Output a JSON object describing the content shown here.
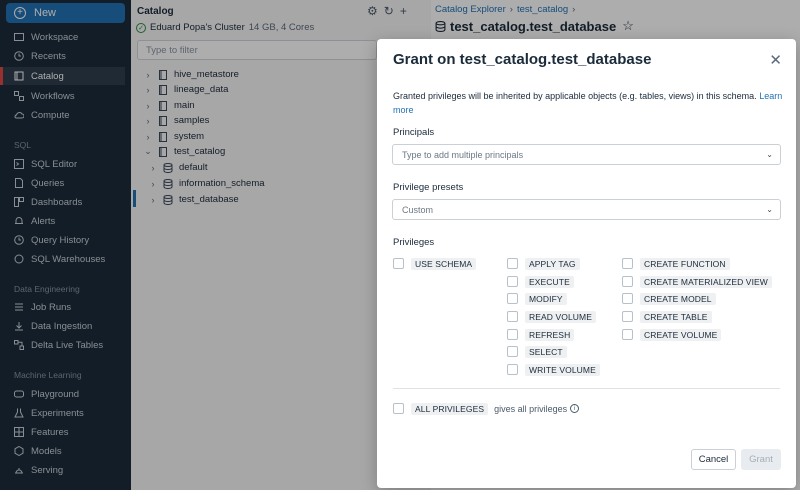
{
  "sidebar": {
    "new_label": "New",
    "items": [
      {
        "label": "Workspace",
        "icon": "folder-icon"
      },
      {
        "label": "Recents",
        "icon": "clock-icon"
      },
      {
        "label": "Catalog",
        "icon": "catalog-icon"
      },
      {
        "label": "Workflows",
        "icon": "workflows-icon"
      },
      {
        "label": "Compute",
        "icon": "cloud-icon"
      }
    ],
    "sql_section": "SQL",
    "sql_items": [
      {
        "label": "SQL Editor",
        "icon": "editor-icon"
      },
      {
        "label": "Queries",
        "icon": "queries-icon"
      },
      {
        "label": "Dashboards",
        "icon": "dashboard-icon"
      },
      {
        "label": "Alerts",
        "icon": "bell-icon"
      },
      {
        "label": "Query History",
        "icon": "history-icon"
      },
      {
        "label": "SQL Warehouses",
        "icon": "warehouse-icon"
      }
    ],
    "de_section": "Data Engineering",
    "de_items": [
      {
        "label": "Job Runs",
        "icon": "jobs-icon"
      },
      {
        "label": "Data Ingestion",
        "icon": "ingestion-icon"
      },
      {
        "label": "Delta Live Tables",
        "icon": "pipeline-icon"
      }
    ],
    "ml_section": "Machine Learning",
    "ml_items": [
      {
        "label": "Playground",
        "icon": "playground-icon"
      },
      {
        "label": "Experiments",
        "icon": "flask-icon"
      },
      {
        "label": "Features",
        "icon": "features-icon"
      },
      {
        "label": "Models",
        "icon": "models-icon"
      },
      {
        "label": "Serving",
        "icon": "serving-icon"
      }
    ]
  },
  "catalog": {
    "title": "Catalog",
    "cluster_name": "Eduard Popa's Cluster",
    "cluster_meta": "14 GB, 4 Cores",
    "filter_placeholder": "Type to filter",
    "tree": [
      "hive_metastore",
      "lineage_data",
      "main",
      "samples",
      "system",
      "test_catalog",
      "default",
      "information_schema",
      "test_database"
    ]
  },
  "header": {
    "crumb1": "Catalog Explorer",
    "crumb2": "test_catalog",
    "title": "test_catalog.test_database"
  },
  "modal": {
    "title": "Grant on test_catalog.test_database",
    "description": "Granted privileges will be inherited by applicable objects (e.g. tables, views) in this schema.",
    "learn_more": "Learn more",
    "principals_label": "Principals",
    "principals_placeholder": "Type to add multiple principals",
    "presets_label": "Privilege presets",
    "presets_value": "Custom",
    "privileges_label": "Privileges",
    "col1": [
      "USE SCHEMA"
    ],
    "col2": [
      "APPLY TAG",
      "EXECUTE",
      "MODIFY",
      "READ VOLUME",
      "REFRESH",
      "SELECT",
      "WRITE VOLUME"
    ],
    "col3": [
      "CREATE FUNCTION",
      "CREATE MATERIALIZED VIEW",
      "CREATE MODEL",
      "CREATE TABLE",
      "CREATE VOLUME"
    ],
    "all_privileges": "ALL PRIVILEGES",
    "all_privileges_note": "gives all privileges",
    "cancel": "Cancel",
    "grant": "Grant"
  }
}
